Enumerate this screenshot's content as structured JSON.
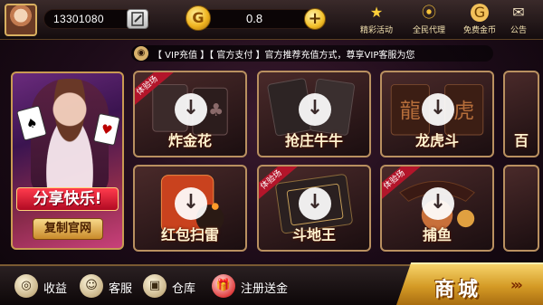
{
  "header": {
    "user_id": "13301080",
    "coins": "0.8",
    "coin_symbol": "G",
    "plus_symbol": "+",
    "nav": [
      {
        "label": "精彩活动",
        "icon": "star-icon",
        "glyph": "★"
      },
      {
        "label": "全民代理",
        "icon": "agent-medal-icon",
        "glyph": "⦿"
      },
      {
        "label": "免费金币",
        "icon": "free-coin-icon",
        "glyph": "G"
      },
      {
        "label": "公告",
        "icon": "mail-icon",
        "glyph": "✉"
      }
    ]
  },
  "marquee": {
    "text": "【 VIP充值 】【 官方支付 】官方推荐充值方式，尊享VIP客服为您"
  },
  "banner": {
    "title": "分享快乐!",
    "button": "复制官网"
  },
  "games": [
    {
      "label": "炸金花",
      "badge": "体验场"
    },
    {
      "label": "抢庄牛牛",
      "badge": ""
    },
    {
      "label": "龙虎斗",
      "badge": ""
    },
    {
      "label": "百",
      "badge": ""
    },
    {
      "label": "红包扫雷",
      "badge": ""
    },
    {
      "label": "斗地王",
      "badge": "体验场"
    },
    {
      "label": "捕鱼",
      "badge": "体验场"
    },
    {
      "label": "",
      "badge": ""
    }
  ],
  "download_glyph": "↓",
  "bottom": {
    "items": [
      {
        "label": "收益",
        "icon": "earnings-icon",
        "glyph": "◎"
      },
      {
        "label": "客服",
        "icon": "customer-service-icon",
        "glyph": "☺"
      },
      {
        "label": "仓库",
        "icon": "warehouse-icon",
        "glyph": "▣"
      },
      {
        "label": "注册送金",
        "icon": "gift-icon",
        "glyph": "🎁"
      }
    ],
    "shop_label": "商城",
    "shop_arrows": "›››"
  }
}
